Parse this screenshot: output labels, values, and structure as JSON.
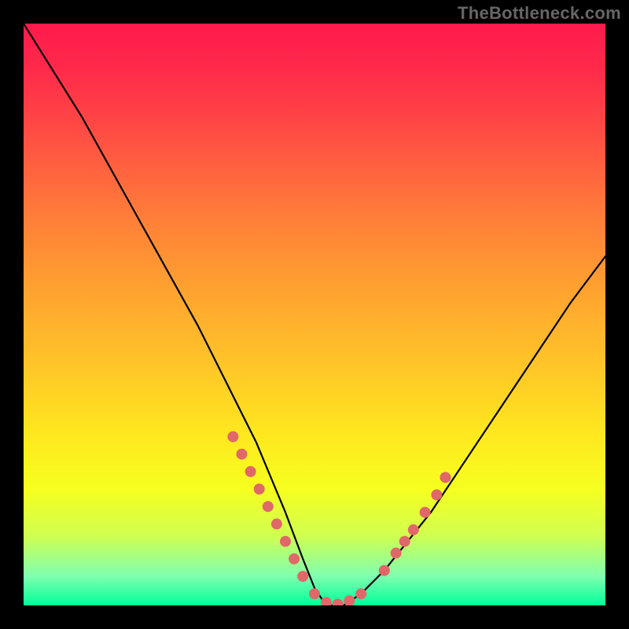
{
  "watermark": "TheBottleneck.com",
  "chart_data": {
    "type": "line",
    "title": "",
    "xlabel": "",
    "ylabel": "",
    "xlim": [
      0,
      100
    ],
    "ylim": [
      0,
      100
    ],
    "grid": false,
    "legend": false,
    "series": [
      {
        "name": "bottleneck-curve",
        "x": [
          0,
          5,
          10,
          15,
          20,
          25,
          30,
          35,
          40,
          45,
          48,
          50,
          52,
          55,
          58,
          62,
          70,
          78,
          86,
          94,
          100
        ],
        "y": [
          100,
          92,
          84,
          75,
          66,
          57,
          48,
          38,
          28,
          16,
          8,
          3,
          0,
          0,
          2,
          6,
          16,
          28,
          40,
          52,
          60
        ]
      }
    ],
    "markers": {
      "name": "highlight-dots",
      "color": "#e06868",
      "points": [
        {
          "x": 36,
          "y": 29
        },
        {
          "x": 37.5,
          "y": 26
        },
        {
          "x": 39,
          "y": 23
        },
        {
          "x": 40.5,
          "y": 20
        },
        {
          "x": 42,
          "y": 17
        },
        {
          "x": 43.5,
          "y": 14
        },
        {
          "x": 45,
          "y": 11
        },
        {
          "x": 46.5,
          "y": 8
        },
        {
          "x": 48,
          "y": 5
        },
        {
          "x": 50,
          "y": 2
        },
        {
          "x": 52,
          "y": 0.5
        },
        {
          "x": 54,
          "y": 0.2
        },
        {
          "x": 56,
          "y": 0.8
        },
        {
          "x": 58,
          "y": 2
        },
        {
          "x": 62,
          "y": 6
        },
        {
          "x": 64,
          "y": 9
        },
        {
          "x": 65.5,
          "y": 11
        },
        {
          "x": 67,
          "y": 13
        },
        {
          "x": 69,
          "y": 16
        },
        {
          "x": 71,
          "y": 19
        },
        {
          "x": 72.5,
          "y": 22
        }
      ]
    },
    "colors": {
      "gradient_top": "#ff1a4d",
      "gradient_mid": "#ffe61f",
      "gradient_bottom": "#00ff99",
      "curve": "#000000",
      "markers": "#e06868",
      "frame": "#000000"
    }
  }
}
